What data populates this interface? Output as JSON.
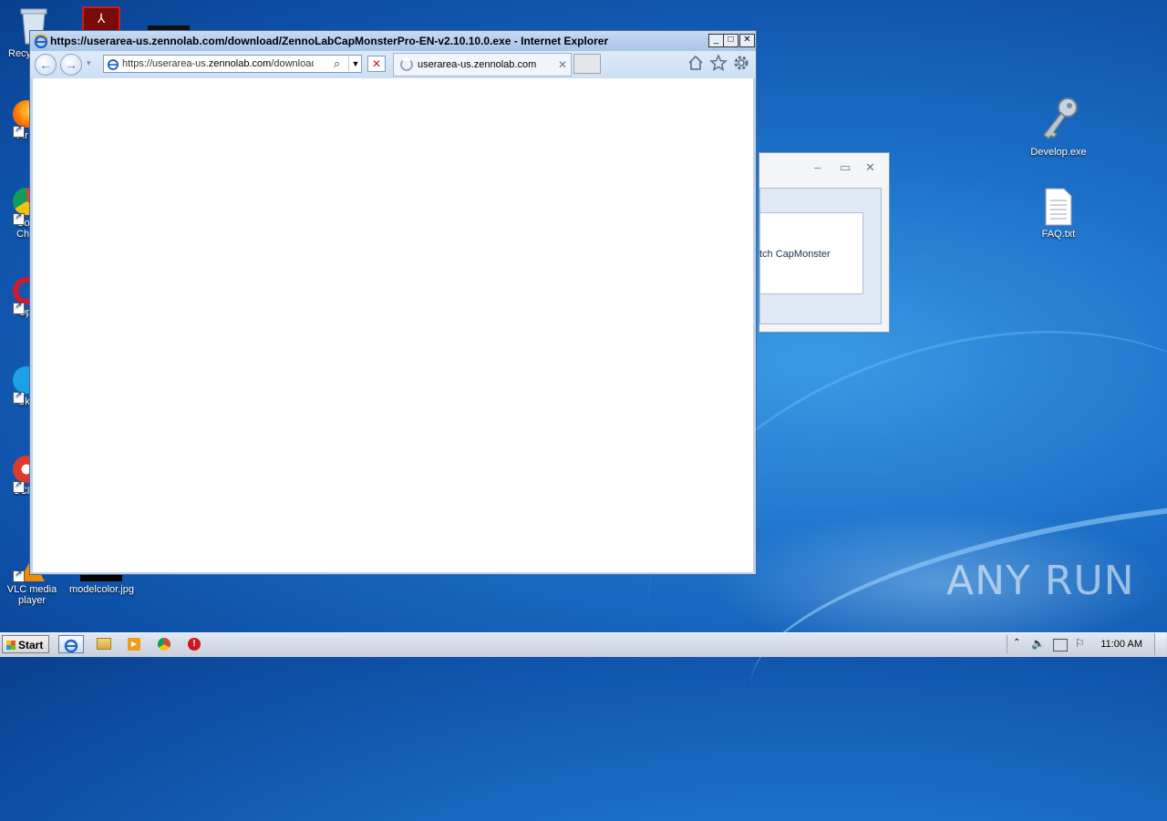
{
  "desktop": {
    "icons_left": [
      {
        "label": "Recy",
        "icon": "recycle-bin-icon"
      },
      {
        "label": "Fir",
        "icon": "firefox-icon"
      },
      {
        "label": "Go Chr",
        "icon": "chrome-icon"
      },
      {
        "label": "Op",
        "icon": "opera-icon"
      },
      {
        "label": "Sk",
        "icon": "skype-icon"
      },
      {
        "label": "CCl",
        "icon": "ccleaner-icon"
      },
      {
        "label": "VLC media player",
        "icon": "vlc-icon"
      },
      {
        "label": "modelcolor.jpg",
        "icon": "image-file-icon"
      }
    ],
    "icons_right": [
      {
        "label": "Develop.exe",
        "icon": "key-icon"
      },
      {
        "label": "FAQ.txt",
        "icon": "text-file-icon"
      }
    ],
    "watermark": "ANY RUN"
  },
  "ie_window": {
    "title": "https://userarea-us.zennolab.com/download/ZennoLabCapMonsterPro-EN-v2.10.10.0.exe - Internet Explorer",
    "address_prefix": "https://userarea-us.",
    "address_domain": "zennolab.com",
    "address_suffix": "/download/Ze",
    "tab_label": "userarea-us.zennolab.com",
    "buttons": {
      "minimize": "_",
      "maximize": "□",
      "close": "✕"
    }
  },
  "bg_dialog": {
    "message": "tch CapMonster"
  },
  "taskbar": {
    "start_label": "Start",
    "clock": "11:00 AM",
    "apps": [
      "internet-explorer-icon",
      "explorer-icon",
      "media-player-icon",
      "chrome-icon",
      "stop-icon"
    ]
  },
  "colors": {
    "desktop": "#1c6fc8",
    "titlebar": "#a9c4e6"
  }
}
